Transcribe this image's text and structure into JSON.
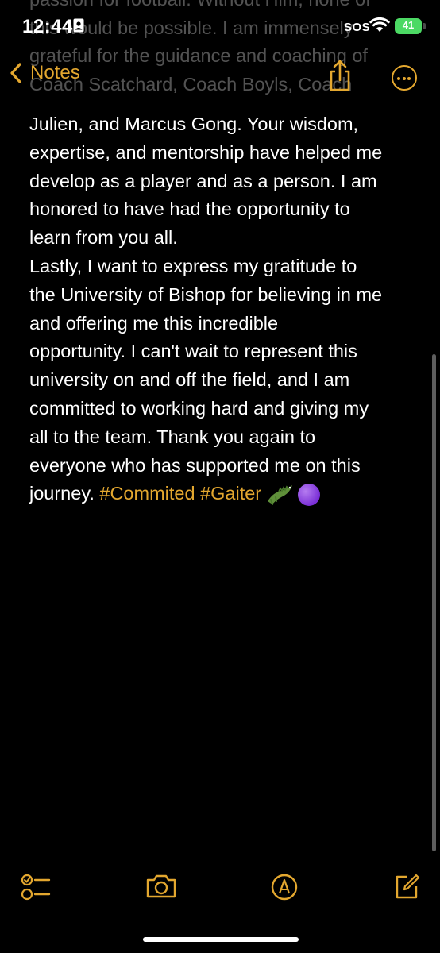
{
  "status_bar": {
    "time": "12:44",
    "carrier": "SOS",
    "battery": "41"
  },
  "nav": {
    "back_label": "Notes"
  },
  "faded_lines": [
    "passion for football. Without Him, none of",
    "this would be possible. I am immensely",
    "grateful for the guidance and coaching of",
    "Coach Scatchard, Coach Boyls, Coach"
  ],
  "note": {
    "lines": [
      "Julien, and Marcus Gong. Your wisdom,",
      "expertise, and mentorship have helped me",
      "develop as a player and as a person. I am",
      "honored to have had the opportunity to",
      "learn from you all.",
      "Lastly, I want to express my gratitude to",
      "the University of Bishop for believing in me",
      "and offering me this incredible",
      "opportunity. I can't wait to represent this",
      "university on and off the field, and I am",
      "committed to working hard and giving my",
      "all to the team. Thank you again to",
      "everyone who has supported me on this"
    ],
    "last_line_text": "journey. ",
    "hashtags": "#Commited #Gaiter"
  },
  "colors": {
    "accent": "#e3a72f",
    "background": "#000000",
    "text": "#ffffff",
    "battery": "#4cd964"
  },
  "icons": {
    "toolbar": [
      "checklist-icon",
      "camera-icon",
      "markup-icon",
      "compose-icon"
    ],
    "nav": [
      "chevron-left-icon",
      "share-icon",
      "more-icon"
    ]
  }
}
